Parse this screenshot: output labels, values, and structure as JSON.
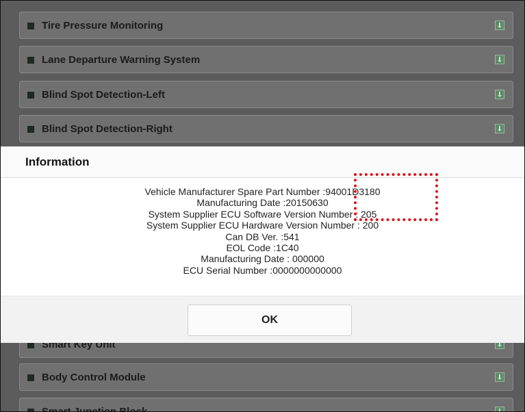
{
  "modules": [
    {
      "label": "Tire Pressure Monitoring"
    },
    {
      "label": "Lane Departure Warning System"
    },
    {
      "label": "Blind Spot Detection-Left"
    },
    {
      "label": "Blind Spot Detection-Right"
    },
    {
      "label": "Smart Key Unit"
    },
    {
      "label": "Body Control Module"
    },
    {
      "label": "Smart Junction Block"
    }
  ],
  "dialog": {
    "title": "Information",
    "lines": [
      "Vehicle Manufacturer Spare Part Number :94001D3180",
      "Manufacturing Date :20150630",
      "System Supplier ECU Software Version Number : 205",
      "System Supplier ECU Hardware Version Number : 200",
      "Can DB Ver. :541",
      "EOL Code :1C40",
      "Manufacturing Date : 000000",
      "ECU Serial Number :0000000000000"
    ],
    "ok_label": "OK"
  },
  "annotation": {
    "color": "#e0121b",
    "style": "dotted"
  }
}
